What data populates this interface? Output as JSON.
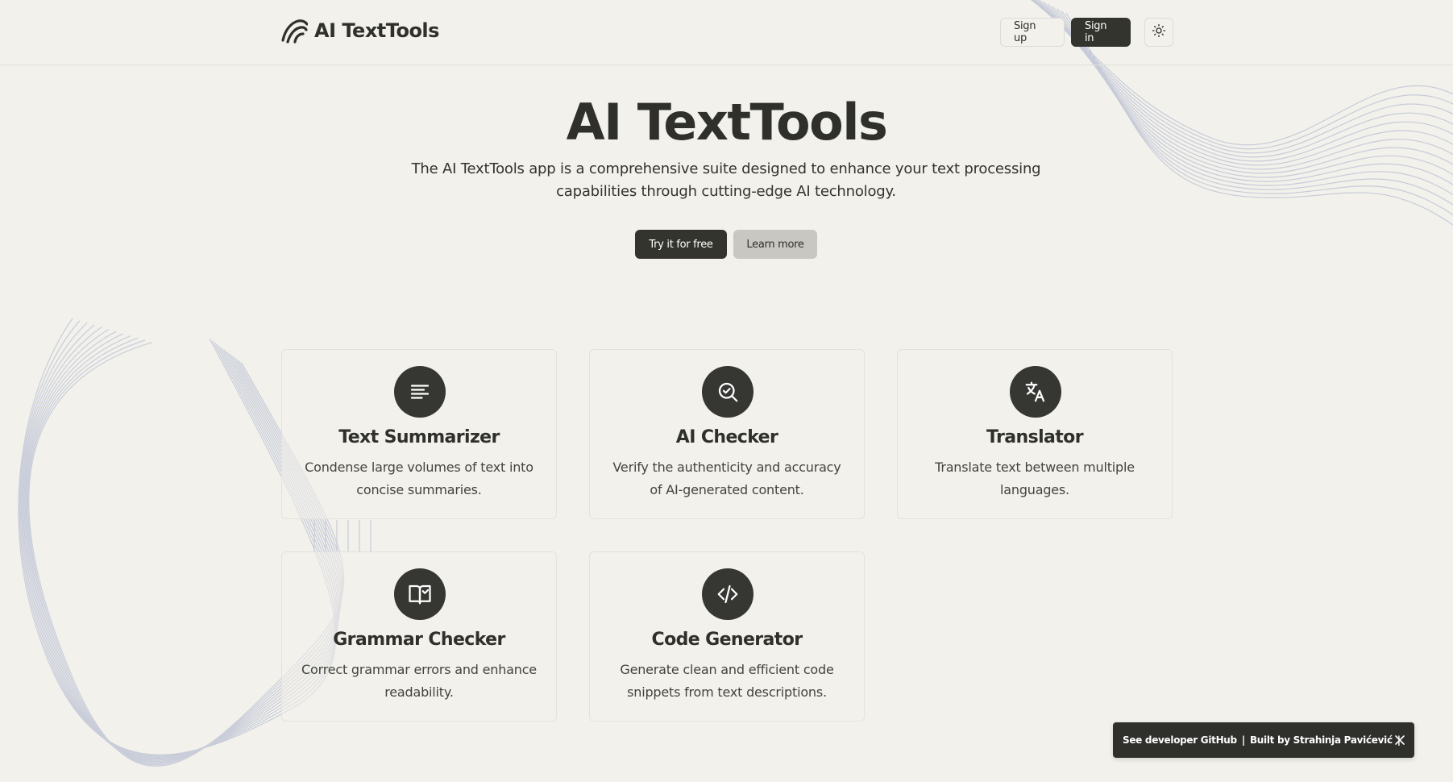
{
  "header": {
    "logo_text": "AI TextTools",
    "signup_label": "Sign up",
    "signin_label": "Sign in",
    "theme_icon": "sun-icon"
  },
  "hero": {
    "title": "AI TextTools",
    "subtitle": "The AI TextTools app is a comprehensive suite designed to enhance your text processing capabilities through cutting-edge AI technology.",
    "try_label": "Try it for free",
    "learn_label": "Learn more"
  },
  "features": [
    {
      "icon": "align-left-icon",
      "title": "Text Summarizer",
      "description": "Condense large volumes of text into concise summaries."
    },
    {
      "icon": "search-check-icon",
      "title": "AI Checker",
      "description": "Verify the authenticity and accuracy of AI-generated content."
    },
    {
      "icon": "languages-icon",
      "title": "Translator",
      "description": "Translate text between multiple languages."
    },
    {
      "icon": "book-check-icon",
      "title": "Grammar Checker",
      "description": "Correct grammar errors and enhance readability."
    },
    {
      "icon": "code-icon",
      "title": "Code Generator",
      "description": "Generate clean and efficient code snippets from text descriptions."
    }
  ],
  "toast": {
    "github_text": "See developer GitHub",
    "separator": "|",
    "built_by": "Built by Strahinja Pavićević",
    "close_icon": "close-icon"
  },
  "colors": {
    "background": "#f2f1eb",
    "primary": "#34342f",
    "secondary_button": "#c8c7c1",
    "wave_stroke": "#b9bfd4"
  }
}
